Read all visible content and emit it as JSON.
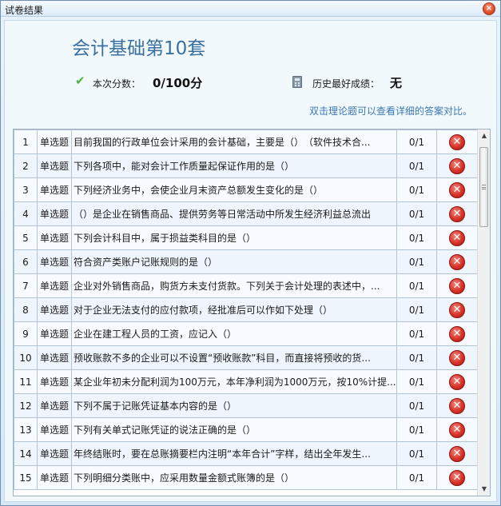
{
  "window": {
    "title": "试卷结果",
    "close_label": "×"
  },
  "exam": {
    "title": "会计基础第10套",
    "score_label": "本次分数：",
    "score_value": "0/100分",
    "best_label": "历史最好成绩：",
    "best_value": "无",
    "hint": "双击理论题可以查看详细的答案对比。"
  },
  "icons": {
    "check": "check-icon",
    "calculator": "calculator-icon",
    "wrong": "wrong-x-icon"
  },
  "colors": {
    "title_blue": "#3a6f9e",
    "wrong_red": "#d8342a",
    "check_green": "#4fb33d"
  },
  "rows": [
    {
      "num": "1",
      "type": "单选题",
      "question": "目前我国的行政单位会计采用的会计基础，主要是（）　（软件技术合...",
      "score": "0/1"
    },
    {
      "num": "2",
      "type": "单选题",
      "question": "下列各项中，能对会计工作质量起保证作用的是（）",
      "score": "0/1"
    },
    {
      "num": "3",
      "type": "单选题",
      "question": "下列经济业务中，会使企业月末资产总额发生变化的是（）",
      "score": "0/1"
    },
    {
      "num": "4",
      "type": "单选题",
      "question": "（）是企业在销售商品、提供劳务等日常活动中所发生经济利益总流出",
      "score": "0/1"
    },
    {
      "num": "5",
      "type": "单选题",
      "question": "下列会计科目中，属于损益类科目的是（）",
      "score": "0/1"
    },
    {
      "num": "6",
      "type": "单选题",
      "question": "符合资产类账户记账规则的是（）",
      "score": "0/1"
    },
    {
      "num": "7",
      "type": "单选题",
      "question": "企业对外销售商品，购货方未支付货款。下列关于会计处理的表述中，...",
      "score": "0/1"
    },
    {
      "num": "8",
      "type": "单选题",
      "question": "对于企业无法支付的应付款项，经批准后可以作如下处理（）",
      "score": "0/1"
    },
    {
      "num": "9",
      "type": "单选题",
      "question": "企业在建工程人员的工资，应记入（）",
      "score": "0/1"
    },
    {
      "num": "10",
      "type": "单选题",
      "question": "预收账款不多的企业可以不设置“预收账款”科目，而直接将预收的货...",
      "score": "0/1"
    },
    {
      "num": "11",
      "type": "单选题",
      "question": "某企业年初未分配利润为100万元，本年净利润为1000万元，按10%计提...",
      "score": "0/1"
    },
    {
      "num": "12",
      "type": "单选题",
      "question": "下列不属于记账凭证基本内容的是（）",
      "score": "0/1"
    },
    {
      "num": "13",
      "type": "单选题",
      "question": "下列有关单式记账凭证的说法正确的是（）",
      "score": "0/1"
    },
    {
      "num": "14",
      "type": "单选题",
      "question": "年终结账时，要在总账摘要栏内注明“本年合计”字样，结出全年发生...",
      "score": "0/1"
    },
    {
      "num": "15",
      "type": "单选题",
      "question": "下列明细分类账中，应采用数量金额式账簿的是（）",
      "score": "0/1"
    }
  ],
  "scrollbar": {
    "up_arrow": "▲",
    "down_arrow": "▼",
    "scroll_fraction": 0.0
  }
}
